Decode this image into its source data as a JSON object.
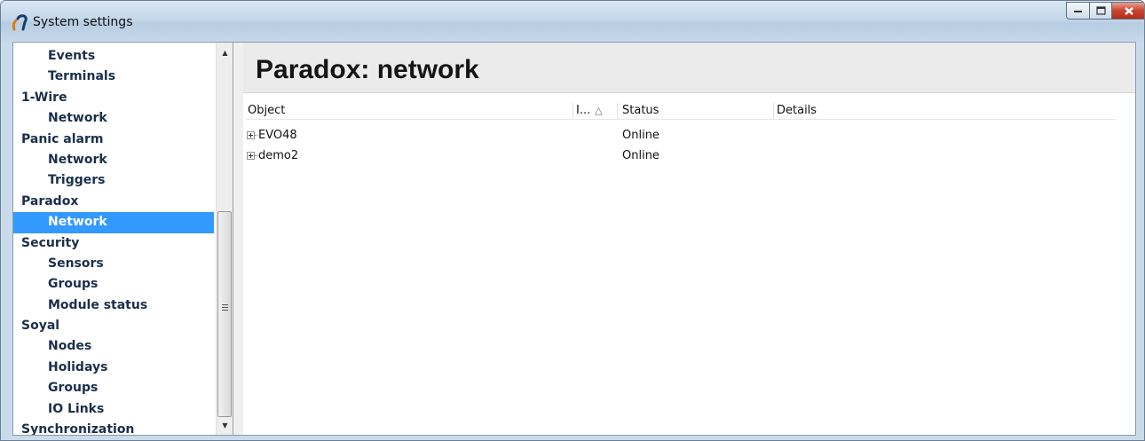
{
  "window": {
    "title": "System settings",
    "icon": "app-logo-icon",
    "controls": [
      "minimize",
      "maximize",
      "close"
    ],
    "close_color": "#c7412c"
  },
  "tree": {
    "items": [
      {
        "label": "Events",
        "level": 1
      },
      {
        "label": "Terminals",
        "level": 1
      },
      {
        "label": "1-Wire",
        "level": 0
      },
      {
        "label": "Network",
        "level": 1
      },
      {
        "label": "Panic alarm",
        "level": 0
      },
      {
        "label": "Network",
        "level": 1
      },
      {
        "label": "Triggers",
        "level": 1
      },
      {
        "label": "Paradox",
        "level": 0
      },
      {
        "label": "Network",
        "level": 1,
        "selected": true
      },
      {
        "label": "Security",
        "level": 0
      },
      {
        "label": "Sensors",
        "level": 1
      },
      {
        "label": "Groups",
        "level": 1
      },
      {
        "label": "Module status",
        "level": 1
      },
      {
        "label": "Soyal",
        "level": 0
      },
      {
        "label": "Nodes",
        "level": 1
      },
      {
        "label": "Holidays",
        "level": 1
      },
      {
        "label": "Groups",
        "level": 1
      },
      {
        "label": "IO Links",
        "level": 1
      },
      {
        "label": "Synchronization",
        "level": 0
      }
    ],
    "selection_color": "#3399ff"
  },
  "main": {
    "title": "Paradox: network",
    "table": {
      "columns": [
        "Object",
        "I...",
        "Status",
        "Details"
      ],
      "sorted_column": "I...",
      "sort_direction": "ascending",
      "rows": [
        {
          "object": "EVO48",
          "i": "",
          "status": "Online",
          "details": ""
        },
        {
          "object": "demo2",
          "i": "",
          "status": "Online",
          "details": ""
        }
      ]
    }
  }
}
